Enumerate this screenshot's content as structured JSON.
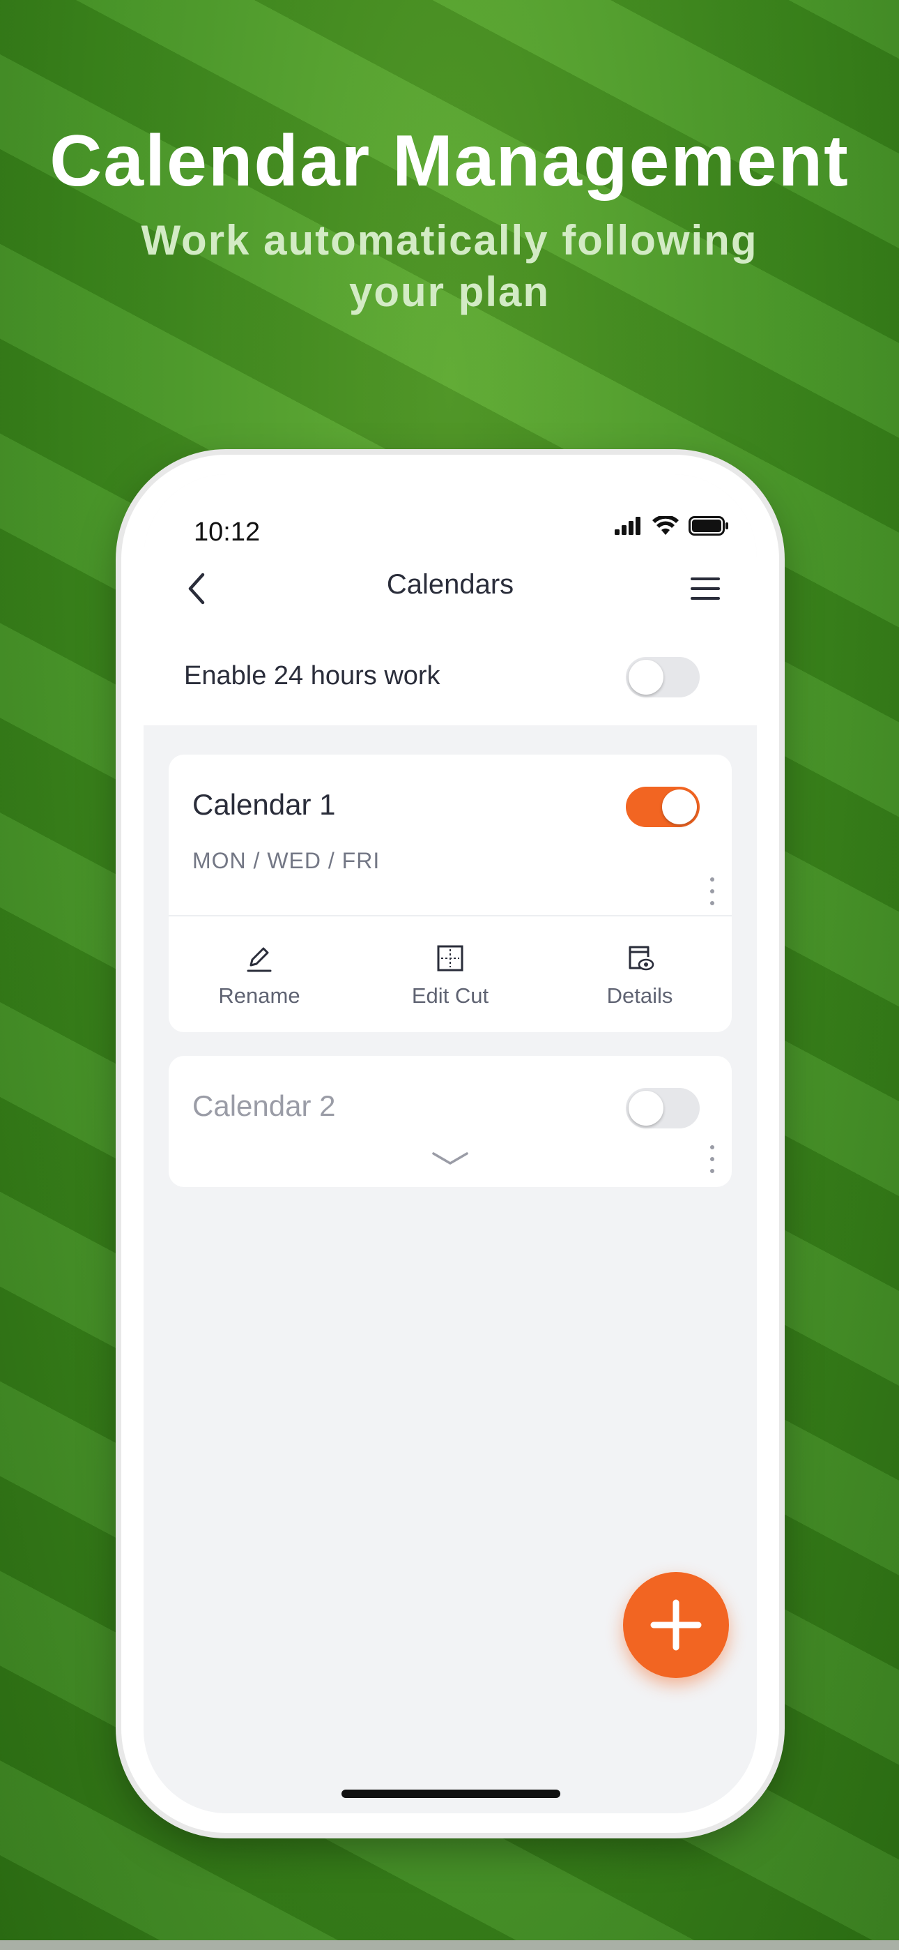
{
  "promo": {
    "headline": "Calendar Management",
    "subheadline": "Work automatically following your plan"
  },
  "status_bar": {
    "time": "10:12",
    "icons": [
      "signal-icon",
      "wifi-icon",
      "battery-icon"
    ]
  },
  "nav": {
    "back_icon": "chevron-left-icon",
    "title": "Calendars",
    "menu_icon": "hamburger-menu-icon"
  },
  "settings": {
    "enable_24h_label": "Enable 24 hours work",
    "enable_24h_on": false
  },
  "calendars": [
    {
      "name": "Calendar 1",
      "enabled": true,
      "days": "MON / WED / FRI",
      "actions": [
        {
          "label": "Rename",
          "icon": "pencil-icon"
        },
        {
          "label": "Edit Cut",
          "icon": "edge-cut-icon"
        },
        {
          "label": "Details",
          "icon": "details-icon"
        }
      ]
    },
    {
      "name": "Calendar 2",
      "enabled": false,
      "expand_icon": "chevron-down-icon"
    }
  ],
  "fab": {
    "icon": "plus-icon"
  },
  "colors": {
    "accent": "#f26522",
    "text_primary": "#2a2d3a",
    "text_secondary": "#737785",
    "screen_bg": "#f2f3f5"
  }
}
